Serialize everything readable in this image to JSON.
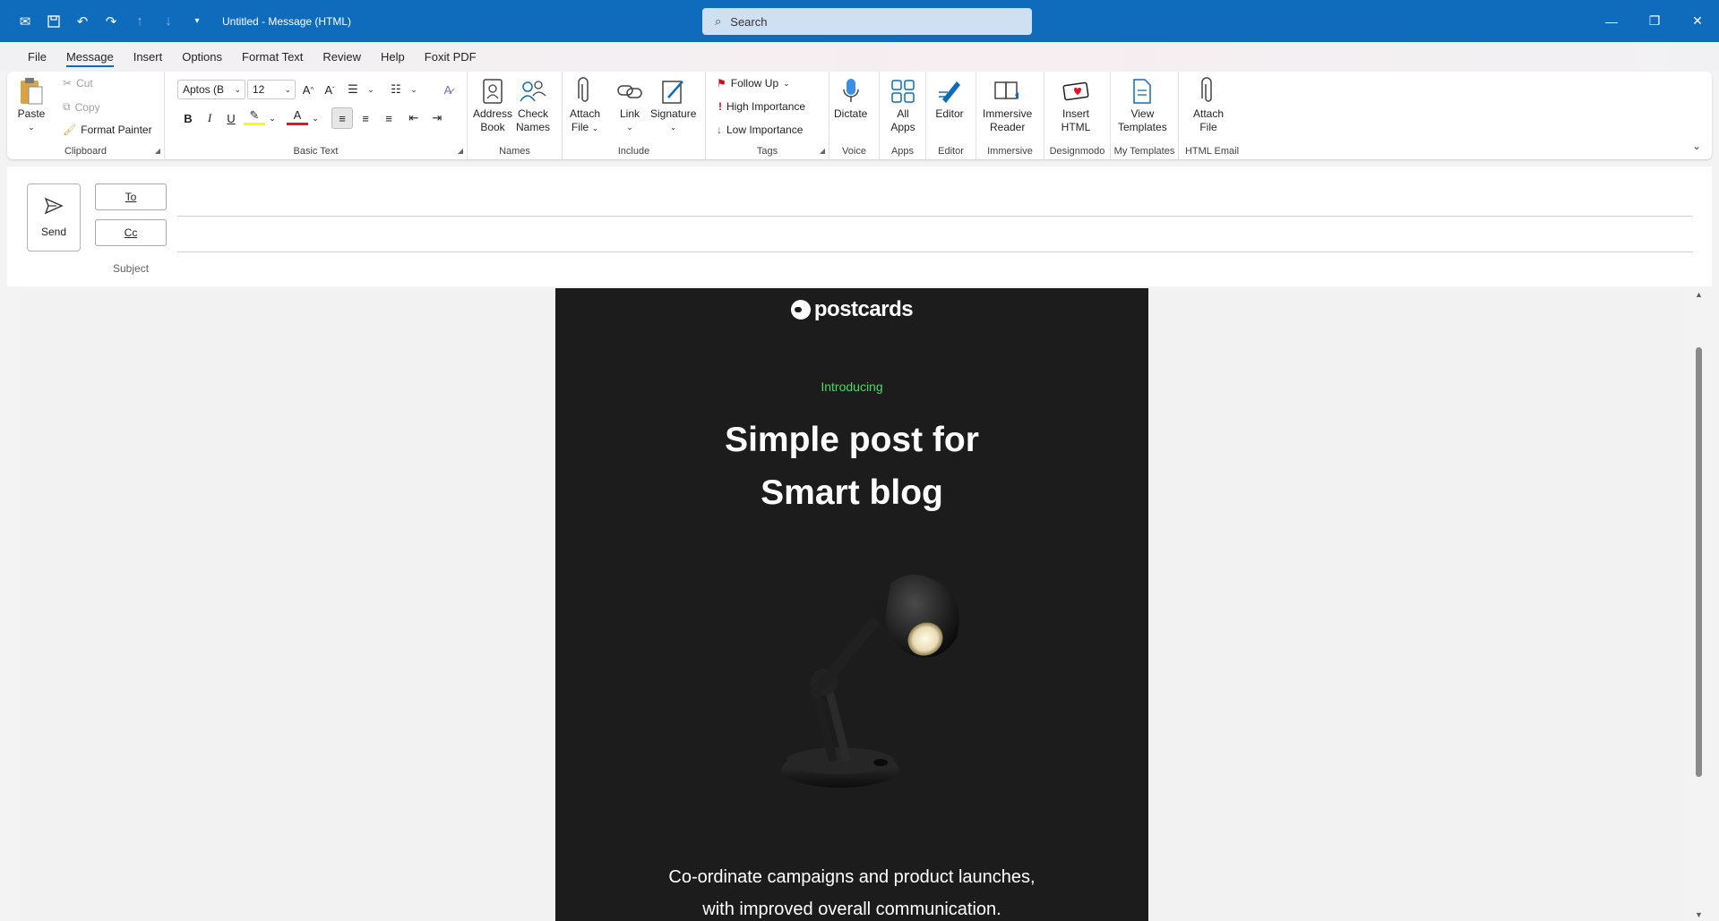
{
  "titlebar": {
    "title": "Untitled  -  Message (HTML)",
    "search_placeholder": "Search"
  },
  "menu": {
    "tabs": [
      "File",
      "Message",
      "Insert",
      "Options",
      "Format Text",
      "Review",
      "Help",
      "Foxit PDF"
    ],
    "active": "Message"
  },
  "ribbon": {
    "clipboard": {
      "paste": "Paste",
      "cut": "Cut",
      "copy": "Copy",
      "format_painter": "Format Painter",
      "label": "Clipboard"
    },
    "basic_text": {
      "font": "Aptos (B",
      "size": "12",
      "label": "Basic Text"
    },
    "names": {
      "address_book_1": "Address",
      "address_book_2": "Book",
      "check_names_1": "Check",
      "check_names_2": "Names",
      "label": "Names"
    },
    "include": {
      "attach_1": "Attach",
      "attach_2": "File",
      "link": "Link",
      "signature": "Signature",
      "label": "Include"
    },
    "tags": {
      "follow_up": "Follow Up",
      "high": "High Importance",
      "low": "Low Importance",
      "label": "Tags"
    },
    "voice": {
      "dictate": "Dictate",
      "label": "Voice"
    },
    "apps": {
      "all_apps_1": "All",
      "all_apps_2": "Apps",
      "label": "Apps"
    },
    "editor": {
      "editor": "Editor",
      "label": "Editor"
    },
    "immersive": {
      "btn_1": "Immersive",
      "btn_2": "Reader",
      "label": "Immersive"
    },
    "designmodo": {
      "btn_1": "Insert",
      "btn_2": "HTML",
      "label": "Designmodo"
    },
    "templates": {
      "btn_1": "View",
      "btn_2": "Templates",
      "label": "My Templates"
    },
    "html_email": {
      "btn_1": "Attach",
      "btn_2": "File",
      "label": "HTML Email"
    }
  },
  "compose": {
    "send": "Send",
    "to": "To",
    "cc": "Cc",
    "subject": "Subject"
  },
  "email": {
    "logo": "postcards",
    "intro": "Introducing",
    "headline_1": "Simple post for",
    "headline_2": "Smart blog",
    "para_1": "Co-ordinate campaigns and product launches,",
    "para_2": "with improved overall communication."
  },
  "colors": {
    "titlebar": "#0f6cbd",
    "accent_green": "#4cd964",
    "email_bg": "#1c1c1c"
  }
}
